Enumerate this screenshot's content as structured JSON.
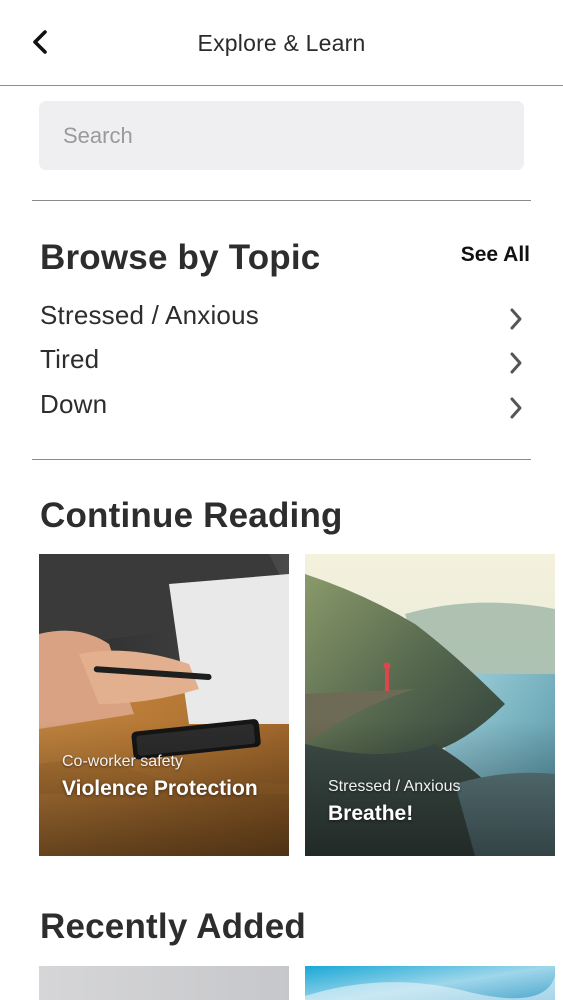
{
  "header": {
    "title": "Explore & Learn",
    "back_icon": "chevron-left-icon"
  },
  "search": {
    "placeholder": "Search"
  },
  "browse": {
    "title": "Browse by Topic",
    "see_all": "See All",
    "topics": [
      {
        "label": "Stressed / Anxious"
      },
      {
        "label": "Tired"
      },
      {
        "label": "Down"
      }
    ]
  },
  "continue_reading": {
    "title": "Continue Reading",
    "cards": [
      {
        "category": "Co-worker safety",
        "title": "Violence Protection"
      },
      {
        "category": "Stressed / Anxious",
        "title": "Breathe!"
      }
    ]
  },
  "recently_added": {
    "title": "Recently Added"
  }
}
